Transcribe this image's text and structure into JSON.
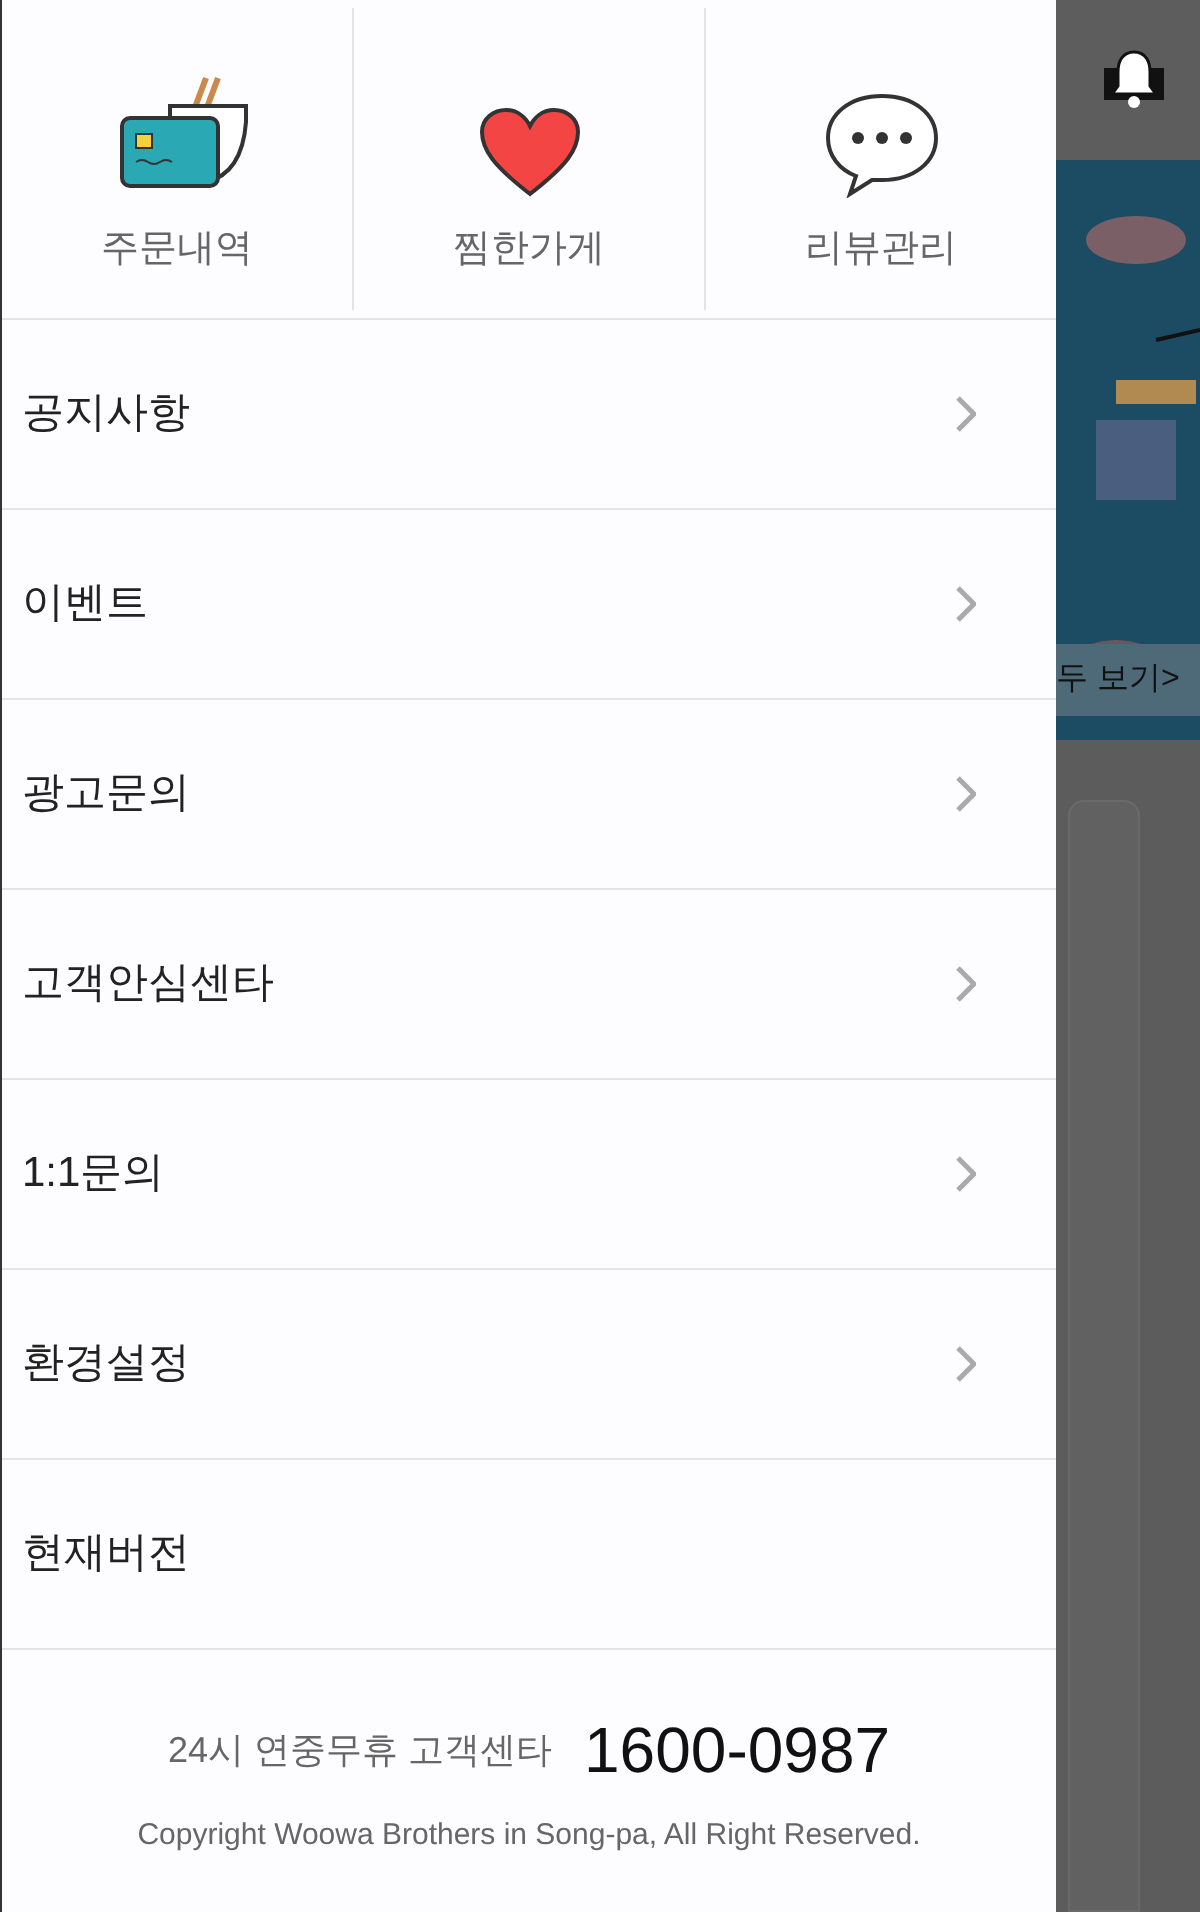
{
  "shortcuts": [
    {
      "kind": "orders",
      "label": "주문내역"
    },
    {
      "kind": "favorites",
      "label": "찜한가게"
    },
    {
      "kind": "reviews",
      "label": "리뷰관리"
    }
  ],
  "menu": [
    {
      "label": "공지사항",
      "arrow": true
    },
    {
      "label": "이벤트",
      "arrow": true
    },
    {
      "label": "광고문의",
      "arrow": true
    },
    {
      "label": "고객안심센타",
      "arrow": true
    },
    {
      "label": "1:1문의",
      "arrow": true
    },
    {
      "label": "환경설정",
      "arrow": true
    },
    {
      "label": "현재버전",
      "arrow": false
    }
  ],
  "footer": {
    "hours": "24시 연중무휴 고객센타",
    "phone": "1600-0987",
    "copyright": "Copyright Woowa Brothers in Song-pa, All Right Reserved."
  },
  "background": {
    "banner_link": "두 보기>"
  }
}
